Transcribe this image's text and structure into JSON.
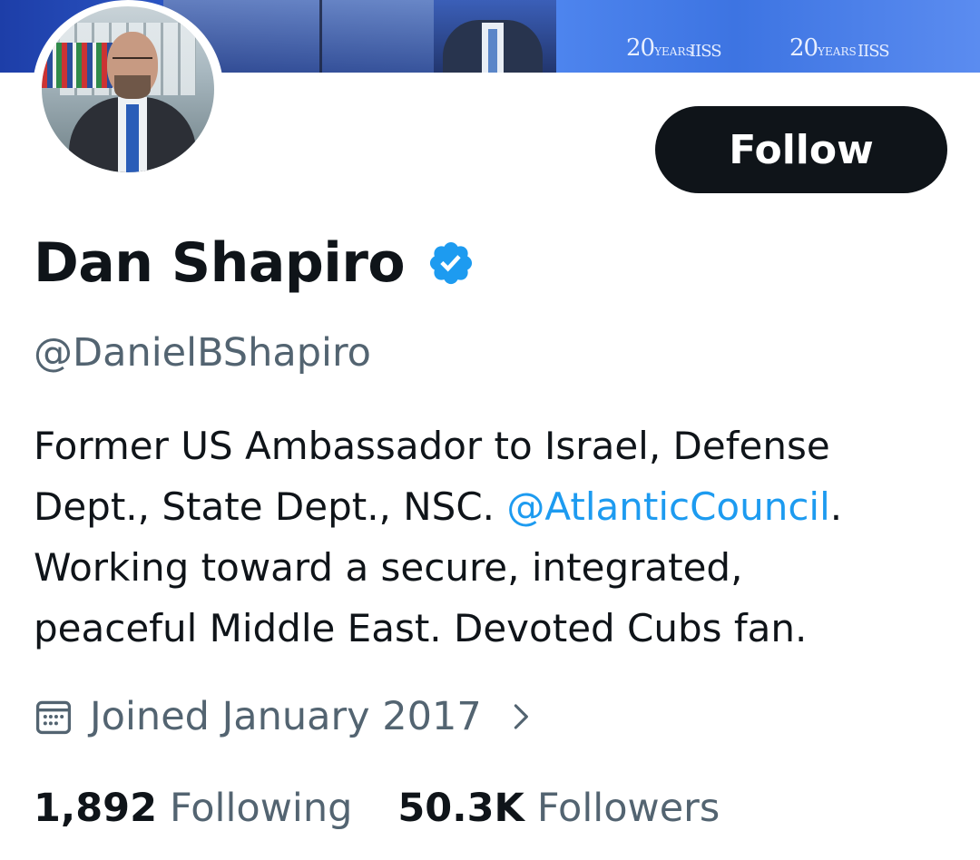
{
  "banner": {
    "logo_text": "20",
    "logo_small": "YEARS",
    "logo_org": "IISS"
  },
  "profile": {
    "display_name": "Dan Shapiro",
    "verified_icon": "verified-badge-icon",
    "handle": "@DanielBShapiro",
    "follow_label": "Follow"
  },
  "bio": {
    "line1": "Former US Ambassador to Israel, Defense",
    "line2_prefix": "Dept., State Dept., NSC. ",
    "line2_mention": "@AtlanticCouncil",
    "line2_suffix": ".",
    "line3": "Working toward a secure, integrated,",
    "line4": "peaceful Middle East. Devoted Cubs fan."
  },
  "joined": {
    "icon": "calendar-icon",
    "text": "Joined January 2017",
    "chevron_icon": "chevron-right-icon"
  },
  "stats": {
    "following_count": "1,892",
    "following_label": "Following",
    "followers_count": "50.3K",
    "followers_label": "Followers"
  },
  "colors": {
    "text_primary": "#0f1419",
    "text_secondary": "#536471",
    "accent_blue": "#1d9bf0",
    "button_bg": "#0f1419"
  }
}
